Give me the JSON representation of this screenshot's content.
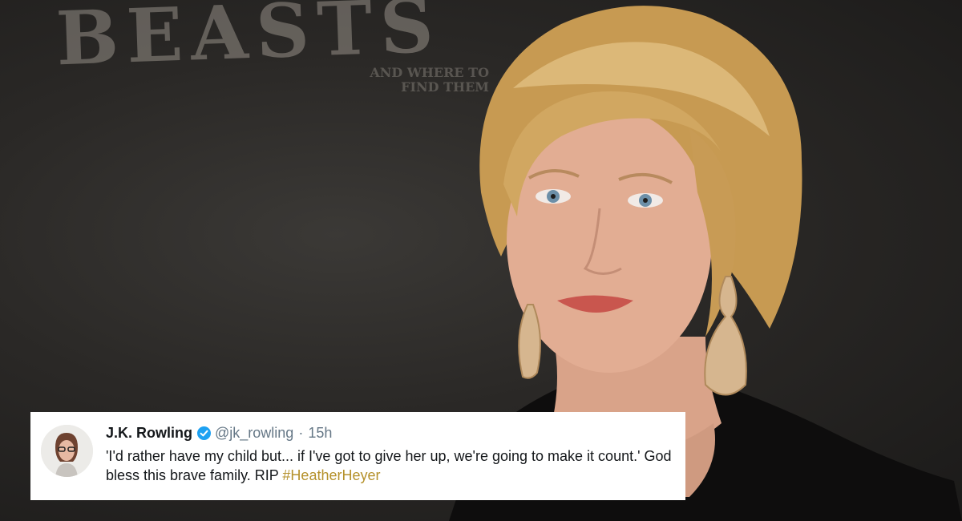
{
  "background": {
    "logo_text": "BEASTS",
    "logo_subtext": "AND WHERE TO FIND THEM"
  },
  "tweet": {
    "author_name": "J.K. Rowling",
    "handle": "@jk_rowling",
    "separator": "·",
    "time_ago": "15h",
    "text": "'I'd rather have my child but... if I've got to give her up, we're going to make it count.' God bless this brave family. RIP ",
    "hashtag": "#HeatherHeyer",
    "verified": true,
    "verified_icon": "verified-badge-icon",
    "colors": {
      "card_background": "#ffffff",
      "name": "#14171a",
      "meta": "#657786",
      "hashtag": "#b5912b",
      "verified_badge": "#1da1f2"
    }
  }
}
